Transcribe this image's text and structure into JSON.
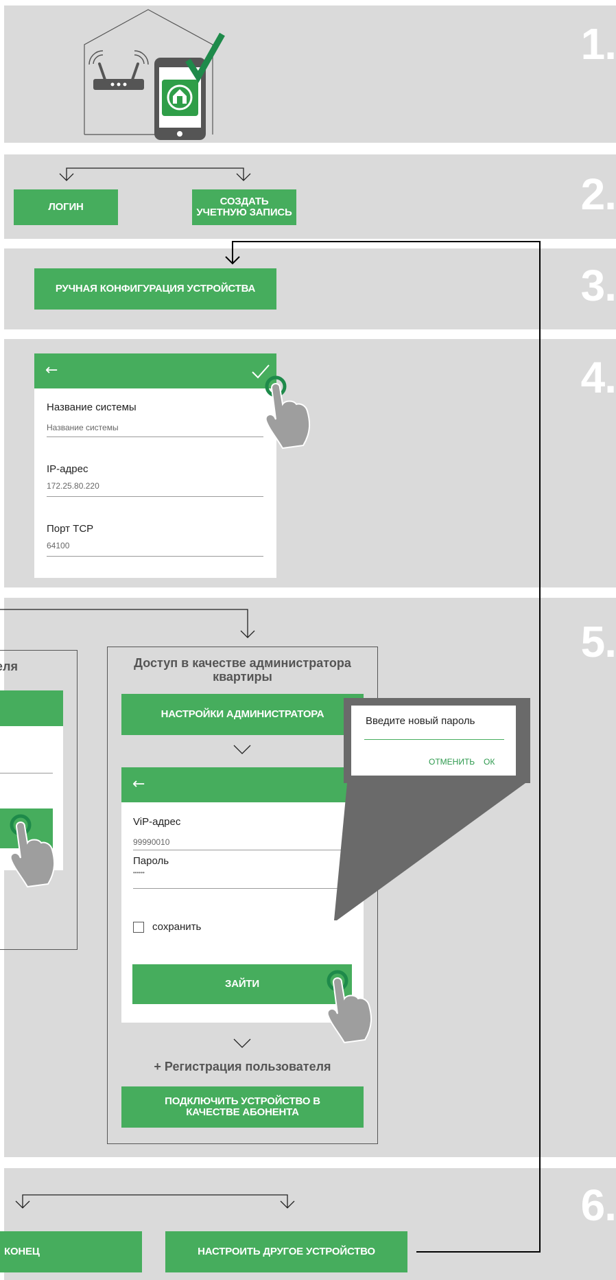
{
  "steps": {
    "s1": {
      "num": "1."
    },
    "s2": {
      "num": "2.",
      "login_label": "ЛОГИН",
      "create_label": "СОЗДАТЬ\nУЧЕТНУЮ ЗАПИСЬ"
    },
    "s3": {
      "num": "3.",
      "manual_config_label": "РУЧНАЯ КОНФИГУРАЦИЯ УСТРОЙСТВА"
    },
    "s4": {
      "num": "4.",
      "fields": [
        {
          "label": "Название системы",
          "value": "Название системы"
        },
        {
          "label": "IP-адрес",
          "value": "172.25.80.220"
        },
        {
          "label": "Порт TCP",
          "value": "64100"
        }
      ]
    },
    "s5": {
      "num": "5.",
      "left_title_fragment": "теля",
      "admin_title": "Доступ в качестве администратора квартиры",
      "admin_settings_label": "НАСТРОЙКИ АДМИНИСТРАТОРА",
      "vip_label": "ViP-адрес",
      "vip_value": "99990010",
      "password_label": "Пароль",
      "password_value": "••••••",
      "save_label": "сохранить",
      "enter_label": "ЗАЙТИ",
      "register_label": "+ Регистрация пользователя",
      "subscriber_label": "ПОДКЛЮЧИТЬ УСТРОЙСТВО В\nКАЧЕСТВЕ АБОНЕНТА",
      "dialog": {
        "title": "Введите новый пароль",
        "cancel_label": "ОТМЕНИТЬ",
        "ok_label": "ОК"
      }
    },
    "s6": {
      "num": "6.",
      "end_label": "КОНЕЦ",
      "other_device_label": "НАСТРОИТЬ ДРУГОЕ УСТРОЙСТВО"
    }
  },
  "colors": {
    "accent": "#46ad5d",
    "dark_green": "#1e8a4a",
    "panel": "#dadada",
    "hand": "#9e9e9e"
  }
}
